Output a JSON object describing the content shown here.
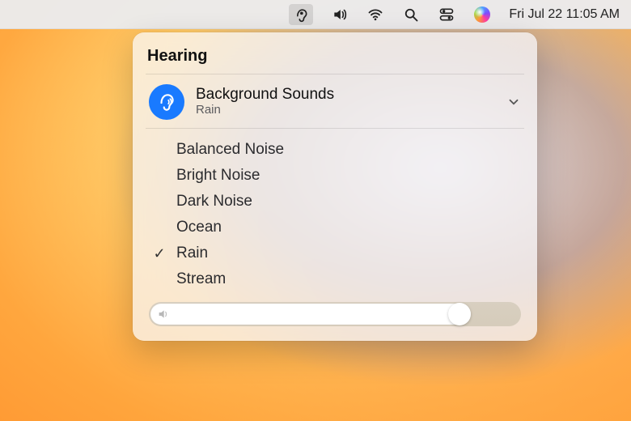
{
  "menubar": {
    "datetime": "Fri Jul 22  11:05 AM",
    "icons": [
      "hearing-icon",
      "volume-icon",
      "wifi-icon",
      "search-icon",
      "control-center-icon",
      "siri-icon"
    ],
    "active_icon": "hearing-icon"
  },
  "panel": {
    "title": "Hearing",
    "section": {
      "icon": "ear-sound-icon",
      "title": "Background Sounds",
      "subtitle": "Rain"
    },
    "sounds": [
      {
        "label": "Balanced Noise",
        "selected": false
      },
      {
        "label": "Bright Noise",
        "selected": false
      },
      {
        "label": "Dark Noise",
        "selected": false
      },
      {
        "label": "Ocean",
        "selected": false
      },
      {
        "label": "Rain",
        "selected": true
      },
      {
        "label": "Stream",
        "selected": false
      }
    ],
    "volume_percent": 86
  },
  "colors": {
    "accent": "#197aff"
  }
}
